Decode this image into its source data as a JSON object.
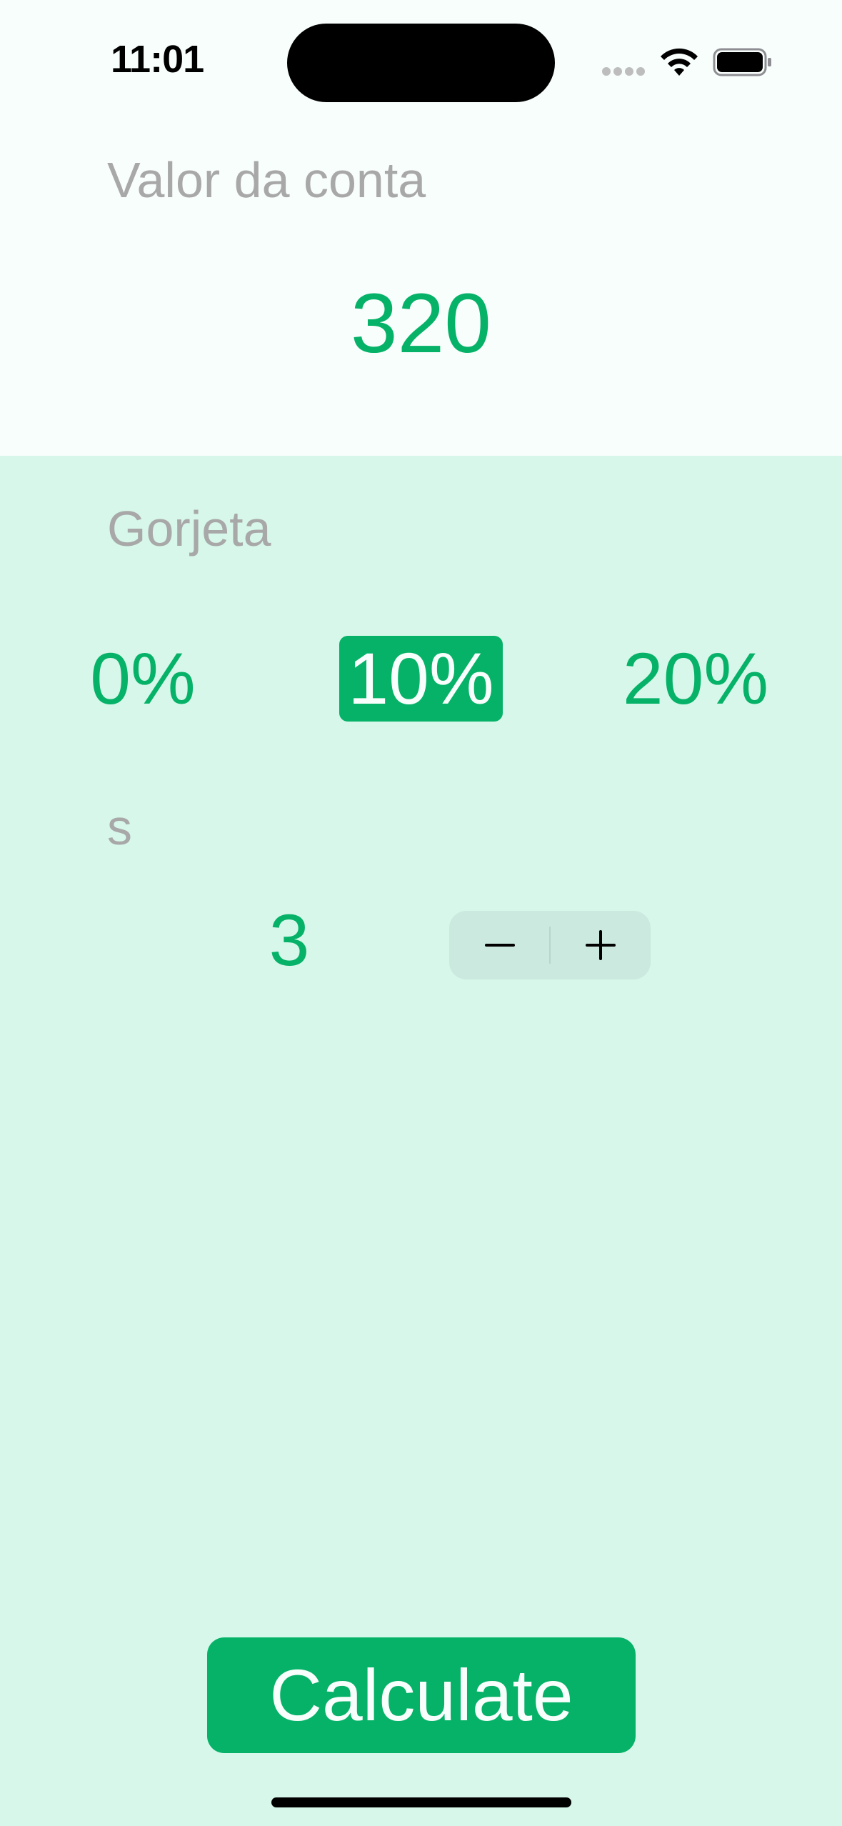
{
  "status_bar": {
    "time": "11:01"
  },
  "bill": {
    "label": "Valor da conta",
    "value": "320"
  },
  "tip": {
    "label": "Gorjeta",
    "options": [
      "0%",
      "10%",
      "20%"
    ],
    "selected": "10%"
  },
  "split": {
    "label": "s",
    "value": "3"
  },
  "actions": {
    "calculate_label": "Calculate"
  },
  "colors": {
    "accent": "#06B268",
    "section_background": "#D7F7EA",
    "top_background": "#F8FEFC",
    "label_text": "#A8A8A8"
  }
}
